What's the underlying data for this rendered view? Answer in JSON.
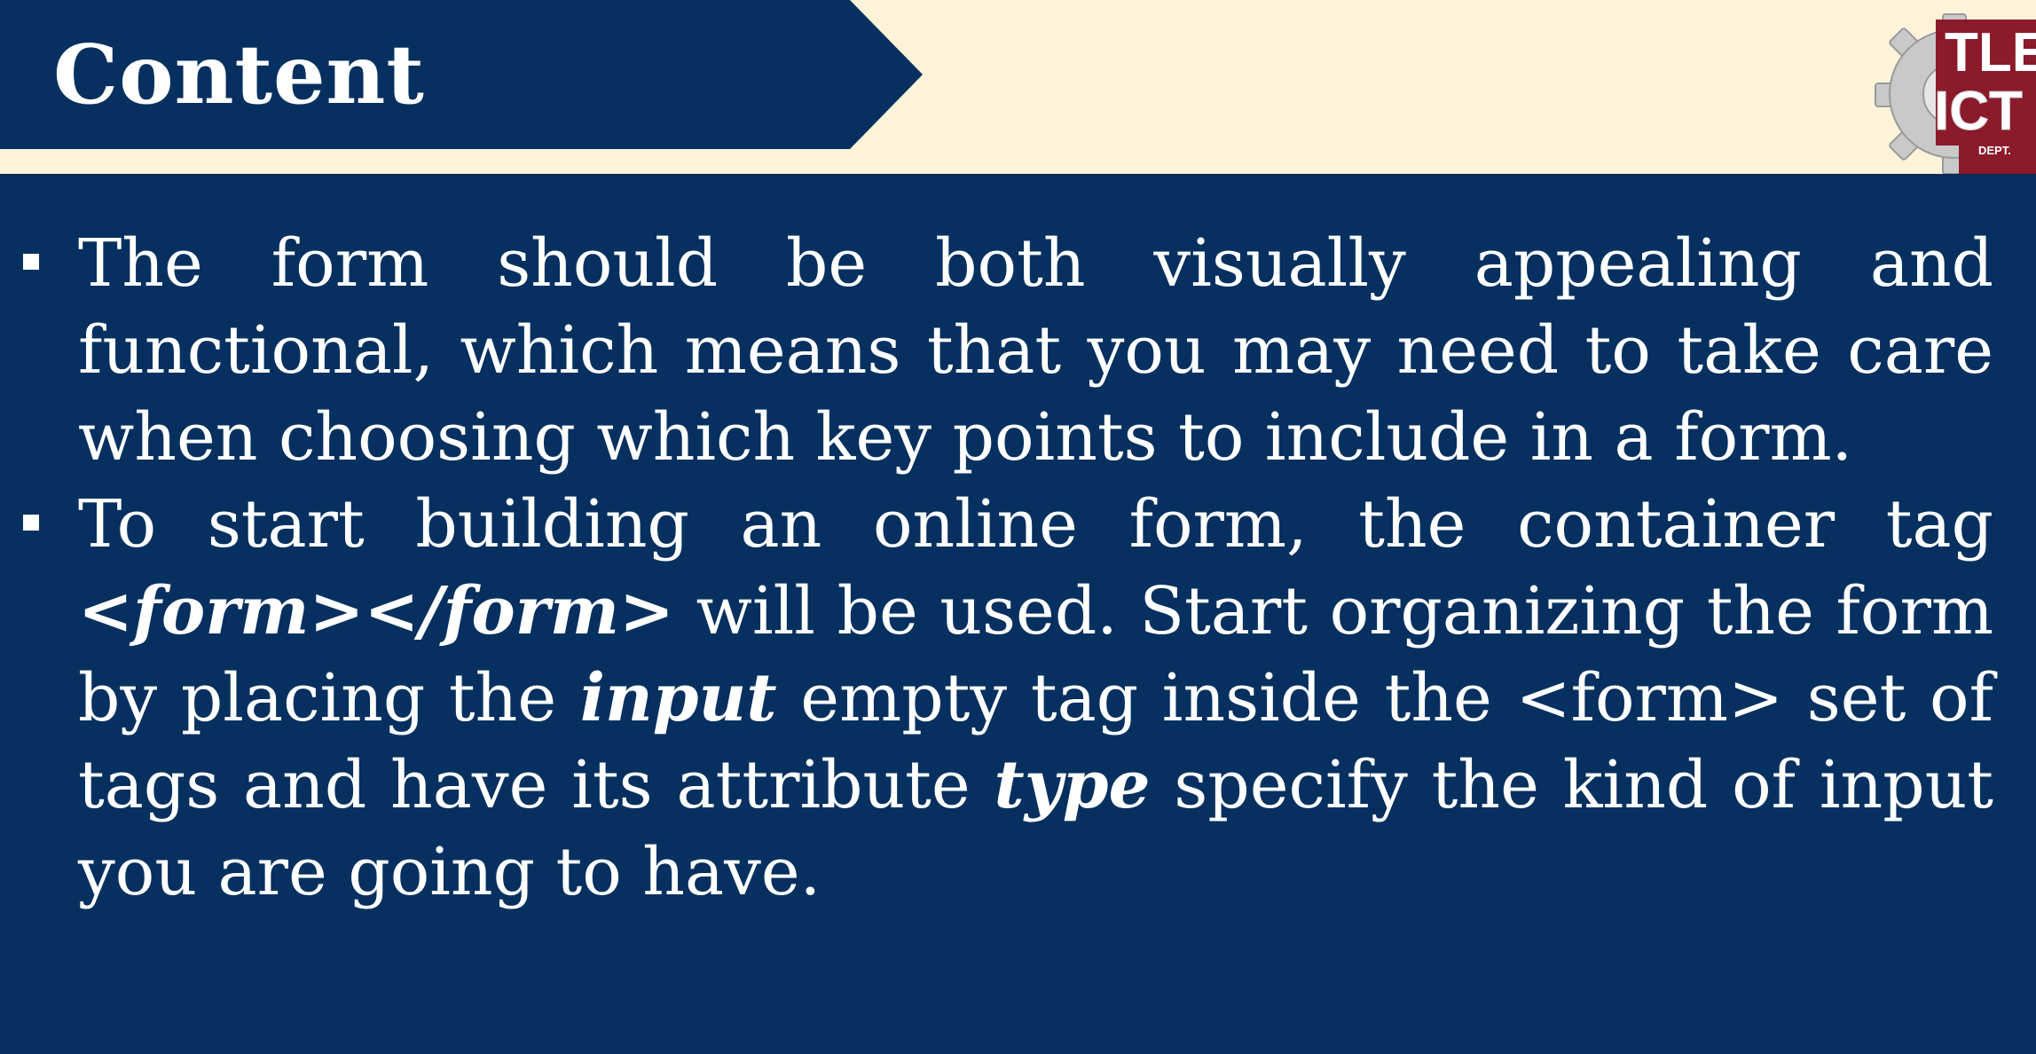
{
  "slide": {
    "title": "Content",
    "logo": {
      "line1": "TLE",
      "line2": "ICT",
      "line3": "DEPT."
    },
    "bullets": [
      {
        "text": "The form should be both visually appealing and functional, which means that you may need to take care when choosing which key points to include in a form."
      },
      {
        "seg1": "To start building an online form, the container tag ",
        "seg2": "<form></form>",
        "seg3": " will be used.  Start organizing the form by placing the ",
        "seg4": "input",
        "seg5": " empty tag inside the <form> set of tags and have its attribute ",
        "seg6": "type",
        "seg7": " specify the kind of input you are going to have."
      }
    ]
  },
  "colors": {
    "navy": "#06305f",
    "cream": "#fdf3d9",
    "maroon": "#8b1a2b",
    "gear_gray": "#c9c9c9"
  },
  "icons": [
    "gear-icon",
    "bullet-square-icon"
  ]
}
